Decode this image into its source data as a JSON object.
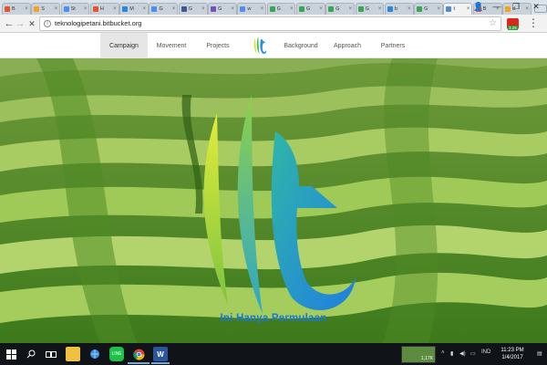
{
  "browser": {
    "tabs": [
      {
        "label": "B",
        "color": "#e8532f"
      },
      {
        "label": "S",
        "color": "#f3a31c"
      },
      {
        "label": "St",
        "color": "#4b8ff0"
      },
      {
        "label": "H",
        "color": "#e8532f"
      },
      {
        "label": "M",
        "color": "#2a88dc"
      },
      {
        "label": "G",
        "color": "#4b8ff0"
      },
      {
        "label": "G",
        "color": "#3b5998"
      },
      {
        "label": "G",
        "color": "#7a4fbf"
      },
      {
        "label": "w",
        "color": "#4b8ff0"
      },
      {
        "label": "G",
        "color": "#34a853"
      },
      {
        "label": "G",
        "color": "#34a853"
      },
      {
        "label": "G",
        "color": "#34a853"
      },
      {
        "label": "G",
        "color": "#34a853"
      },
      {
        "label": "b",
        "color": "#2a88dc"
      },
      {
        "label": "G",
        "color": "#34a853"
      },
      {
        "label": "t",
        "color": "#4a8bdc"
      },
      {
        "label": "B",
        "color": "#e8532f"
      },
      {
        "label": "d",
        "color": "#f3a31c"
      }
    ],
    "tab_close_glyph": "×",
    "active_tab_index": 15,
    "url": "teknologipetani.bitbucket.org",
    "reload_glyph": "✕",
    "back_glyph": "←",
    "forward_glyph": "→",
    "star_glyph": "☆",
    "menu_glyph": "⋮",
    "window": {
      "min": "—",
      "max": "❐",
      "close": "✕"
    },
    "extension_badge": "3.26"
  },
  "sitenav": {
    "items": [
      {
        "label": "Campaign",
        "active": true
      },
      {
        "label": "Movement",
        "active": false
      },
      {
        "label": "Projects",
        "active": false
      },
      {
        "label": "Background",
        "active": false
      },
      {
        "label": "Approach",
        "active": false
      },
      {
        "label": "Partners",
        "active": false
      }
    ],
    "logo_icon": "lt-logo-icon"
  },
  "hero": {
    "tagline": "Ini Hanya Permulaan",
    "colors": {
      "logo_light": "#d8e43a",
      "logo_green": "#4cbf5a",
      "logo_blue": "#2b8fe0"
    }
  },
  "taskbar": {
    "apps": [
      "windows-start-icon",
      "search-icon",
      "task-view-icon",
      "explorer-icon",
      "line-icon",
      "chrome-icon",
      "word-icon"
    ],
    "thumbnail_text": "1,17K",
    "tray": {
      "lang": "IND",
      "time": "11:23 PM",
      "date": "1/4/2017"
    }
  }
}
